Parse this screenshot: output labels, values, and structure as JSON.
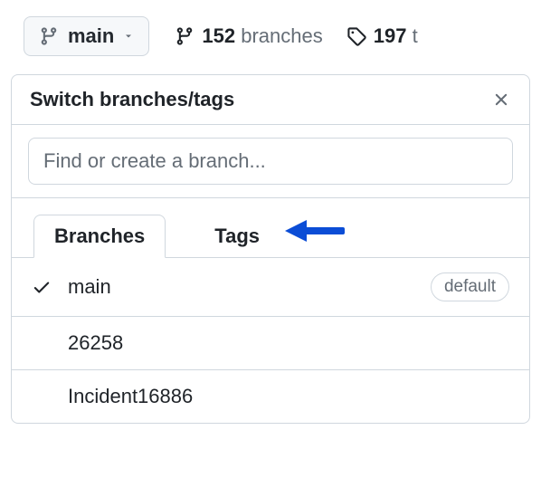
{
  "top": {
    "current_branch": "main",
    "branches_count": "152",
    "branches_label": "branches",
    "tags_count": "197",
    "tags_label_truncated": "t"
  },
  "popover": {
    "title": "Switch branches/tags",
    "search_placeholder": "Find or create a branch...",
    "tabs": {
      "branches": "Branches",
      "tags": "Tags"
    },
    "default_badge": "default",
    "branches": [
      {
        "name": "main",
        "checked": true,
        "default": true
      },
      {
        "name": "26258",
        "checked": false,
        "default": false
      },
      {
        "name": "Incident16886",
        "checked": false,
        "default": false
      }
    ]
  }
}
